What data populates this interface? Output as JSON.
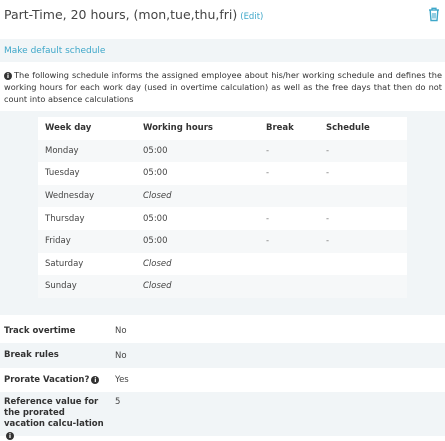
{
  "header": {
    "title": "Part-Time, 20 hours, (mon,tue,thu,fri)",
    "edit_label": "(Edit)"
  },
  "default_schedule_label": "Make default schedule",
  "info_text": "The following schedule informs the assigned employee about his/her working schedule and defines the working hours for each work day (used in overtime calculation) as well as the free days that then do not count into absence calculations",
  "schedule": {
    "columns": [
      "Week day",
      "Working hours",
      "Break",
      "Schedule"
    ],
    "rows": [
      {
        "day": "Monday",
        "hours": "05:00",
        "break": "-",
        "schedule": "-"
      },
      {
        "day": "Tuesday",
        "hours": "05:00",
        "break": "-",
        "schedule": "-"
      },
      {
        "day": "Wednesday",
        "hours": "Closed",
        "break": "",
        "schedule": ""
      },
      {
        "day": "Thursday",
        "hours": "05:00",
        "break": "-",
        "schedule": "-"
      },
      {
        "day": "Friday",
        "hours": "05:00",
        "break": "-",
        "schedule": "-"
      },
      {
        "day": "Saturday",
        "hours": "Closed",
        "break": "",
        "schedule": ""
      },
      {
        "day": "Sunday",
        "hours": "Closed",
        "break": "",
        "schedule": ""
      }
    ]
  },
  "properties": [
    {
      "label": "Track overtime",
      "value": "No"
    },
    {
      "label": "Break rules",
      "value": "No"
    },
    {
      "label": "Prorate Vacation?",
      "value": "Yes"
    },
    {
      "label": "Reference value for the prorated vacation calcu-lation",
      "value": "5"
    }
  ],
  "icons": {
    "trash": "trash-icon",
    "info": "info-icon"
  },
  "colors": {
    "link": "#3ea7c9",
    "panel_bg": "#f1f5f7"
  }
}
